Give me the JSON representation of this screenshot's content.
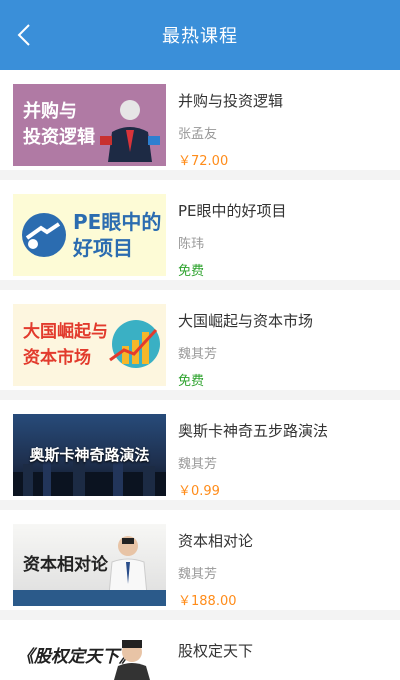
{
  "header": {
    "title": "最热课程",
    "back_icon": "chevron-left-icon"
  },
  "courses": [
    {
      "title": "并购与投资逻辑",
      "teacher": "张孟友",
      "price": "￥72.00",
      "thumb_lines": [
        "并购与",
        "投资逻辑"
      ]
    },
    {
      "title": "PE眼中的好项目",
      "teacher": "陈玮",
      "price": "免费",
      "thumb_lines": [
        "PE眼中的",
        "好项目"
      ]
    },
    {
      "title": "大国崛起与资本市场",
      "teacher": "魏其芳",
      "price": "免费",
      "thumb_lines": [
        "大国崛起与",
        "资本市场"
      ]
    },
    {
      "title": "奥斯卡神奇五步路演法",
      "teacher": "魏其芳",
      "price": "￥0.99",
      "thumb_lines": [
        "奥斯卡神奇路演法"
      ]
    },
    {
      "title": "资本相对论",
      "teacher": "魏其芳",
      "price": "￥188.00",
      "thumb_lines": [
        "资本相对论"
      ]
    },
    {
      "title": "股权定天下",
      "thumb_lines": [
        "《股权定天下》"
      ]
    }
  ],
  "colors": {
    "header": "#3a8fd9",
    "price_paid": "#ff8c1a",
    "price_free": "#2fa32f"
  }
}
